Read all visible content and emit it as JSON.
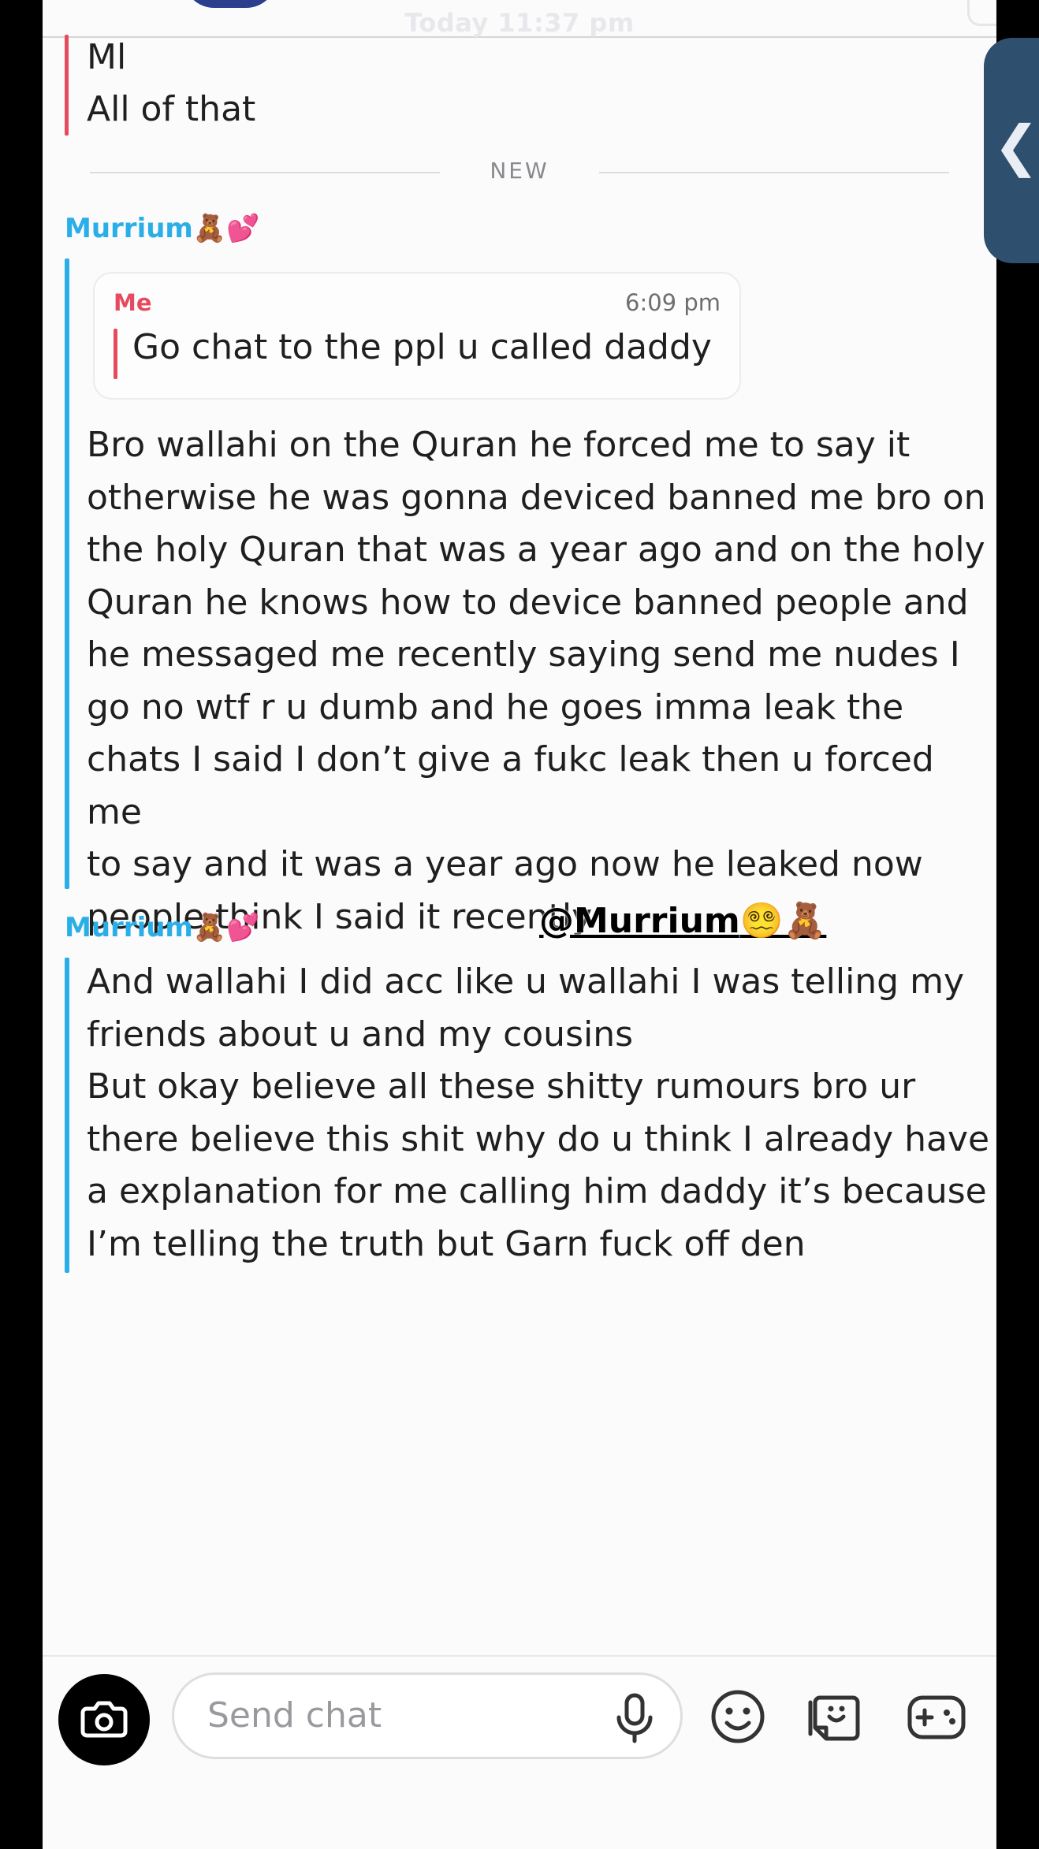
{
  "header": {
    "time": "Today 11:37 pm"
  },
  "earlier": {
    "lines": [
      "Ml",
      "All of that"
    ]
  },
  "divider": {
    "label": "NEW"
  },
  "messages": [
    {
      "sender": "Murrium",
      "sender_emojis": "🧸💕",
      "quote": {
        "sender": "Me",
        "time": "6:09 pm",
        "text": "Go chat to the ppl u called daddy"
      },
      "lines": [
        "Bro wallahi on the Quran he forced me to say it",
        "otherwise he was gonna deviced banned me bro on",
        "the holy Quran that was a year ago and on the holy",
        "Quran he knows how to device banned people and",
        "he messaged me recently saying send me nudes I",
        "go no wtf r u dumb and he goes imma leak the",
        "chats I said I don’t give a fukc leak then u forced me",
        "to say and it was a year ago now he leaked now",
        "people think I said it recently"
      ]
    },
    {
      "sender": "Murrium",
      "sender_emojis": "🧸💕",
      "lines": [
        "And wallahi I did acc like u wallahi I was telling my",
        "friends about u and my cousins",
        "But okay believe all these shitty rumours bro ur",
        "there believe this shit why do u think I already have",
        "a explanation for me calling him daddy it’s because",
        "I’m telling the truth but Garn fuck off den"
      ]
    }
  ],
  "overlay": {
    "handle": "@Murrium",
    "handle_emojis": "😵‍💫🧸"
  },
  "side_handle": {
    "glyph": "❮"
  },
  "composer": {
    "placeholder": "Send chat"
  },
  "icons": {
    "camera": "camera-icon",
    "mic": "microphone-icon",
    "emoji": "smiley-icon",
    "stickers": "sticker-icon",
    "games": "gamepad-icon",
    "emoji_colors": {
      "teddy": "#b4782f",
      "heart": "#f56aa8",
      "dizzy": "#f2c94c"
    }
  }
}
